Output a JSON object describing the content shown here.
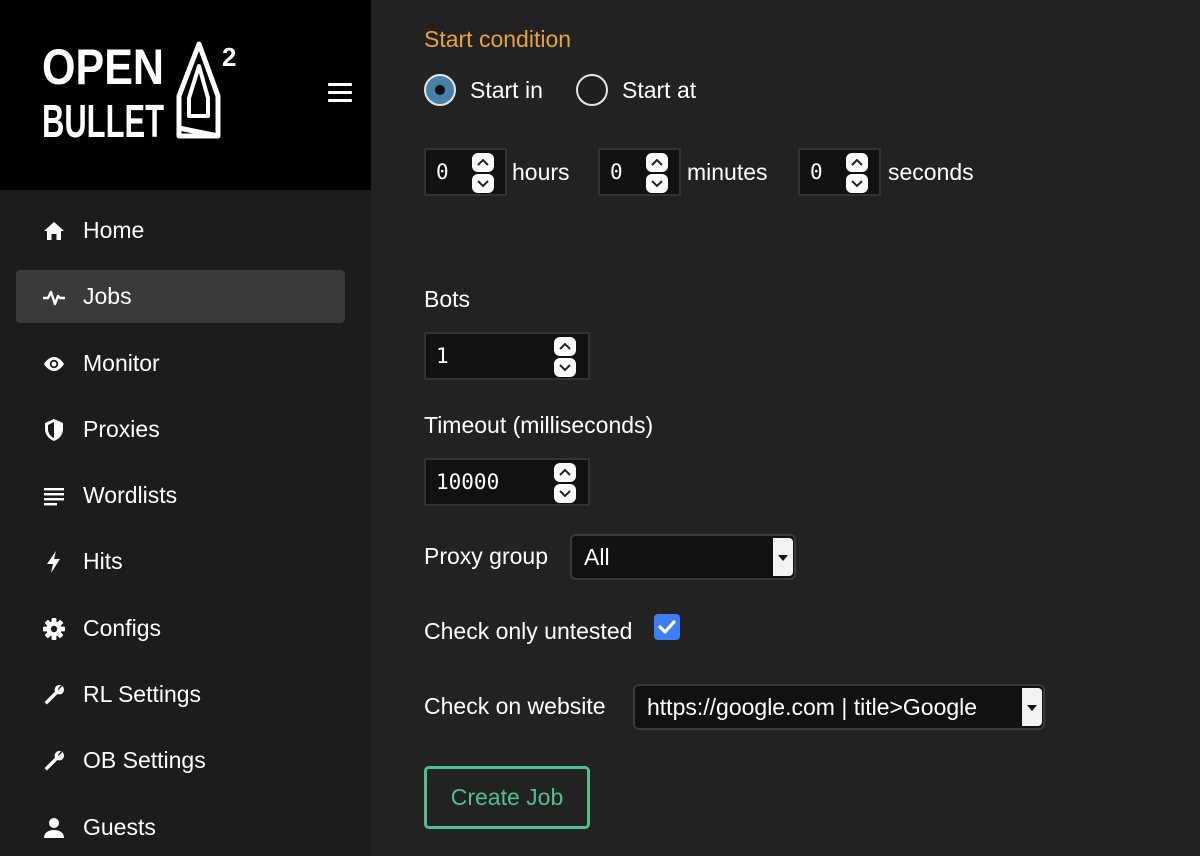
{
  "brand": {
    "logo_line1": "OPEN",
    "logo_line2": "BULLET",
    "logo_superscript": "2",
    "logo_icon": "boat-logo-icon"
  },
  "header": {
    "menu_icon": "hamburger-icon"
  },
  "sidebar": {
    "items": [
      {
        "label": "Home",
        "icon": "home-icon",
        "active": false
      },
      {
        "label": "Jobs",
        "icon": "pulse-icon",
        "active": true
      },
      {
        "label": "Monitor",
        "icon": "eye-icon",
        "active": false
      },
      {
        "label": "Proxies",
        "icon": "shield-icon",
        "active": false
      },
      {
        "label": "Wordlists",
        "icon": "lines-icon",
        "active": false
      },
      {
        "label": "Hits",
        "icon": "bolt-icon",
        "active": false
      },
      {
        "label": "Configs",
        "icon": "gear-icon",
        "active": false
      },
      {
        "label": "RL Settings",
        "icon": "wrench-icon",
        "active": false
      },
      {
        "label": "OB Settings",
        "icon": "wrench-icon",
        "active": false
      },
      {
        "label": "Guests",
        "icon": "user-icon",
        "active": false
      }
    ]
  },
  "form": {
    "start_condition": {
      "title": "Start condition",
      "options": [
        {
          "label": "Start in",
          "checked": true
        },
        {
          "label": "Start at",
          "checked": false
        }
      ],
      "hours": {
        "value": "0",
        "unit": "hours"
      },
      "minutes": {
        "value": "0",
        "unit": "minutes"
      },
      "seconds": {
        "value": "0",
        "unit": "seconds"
      }
    },
    "bots": {
      "label": "Bots",
      "value": "1"
    },
    "timeout": {
      "label": "Timeout (milliseconds)",
      "value": "10000"
    },
    "proxy_group": {
      "label": "Proxy group",
      "value": "All"
    },
    "check_only_untested": {
      "label": "Check only untested",
      "checked": true
    },
    "check_on_website": {
      "label": "Check on website",
      "value": "https://google.com | title>Google"
    },
    "submit_label": "Create Job"
  },
  "colors": {
    "accent_orange": "#e8a33c",
    "button_green": "#4fc08d",
    "checkbox_blue": "#3d7ef0",
    "radio_blue": "#4a7fa7",
    "sidebar_active": "#3a3a3a"
  }
}
